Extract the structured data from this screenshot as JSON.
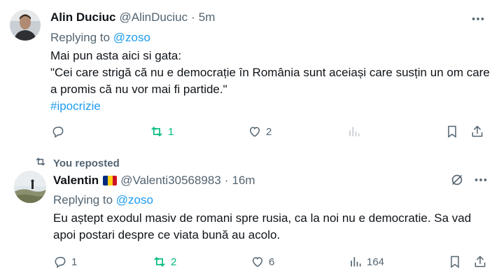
{
  "tweets": [
    {
      "author_name": "Alin Duciuc",
      "handle": "@AlinDuciuc",
      "separator": "·",
      "time": "5m",
      "replying_prefix": "Replying to",
      "replying_to": "@zoso",
      "lines": [
        "Mai pun asta aici si gata:",
        "\"Cei care strigă că nu e democrație în România sunt aceiași care susțin un om care a promis că nu vor mai fi partide.\""
      ],
      "hashtag": "#ipocrizie",
      "reply_count": "",
      "repost_count": "1",
      "like_count": "2",
      "view_count": ""
    },
    {
      "repost_label": "You reposted",
      "author_name": "Valentin",
      "handle": "@Valenti30568983",
      "separator": "·",
      "time": "16m",
      "replying_prefix": "Replying to",
      "replying_to": "@zoso",
      "text": "Eu aștept exodul masiv de romani spre rusia, ca la noi nu e democratie. Sa vad apoi postari despre ce viata bună au acolo.",
      "reply_count": "1",
      "repost_count": "2",
      "like_count": "6",
      "view_count": "164"
    }
  ],
  "colors": {
    "link": "#1d9bf0",
    "muted": "#536471",
    "repost_green": "#00ba7c",
    "text": "#0f1419"
  },
  "icons": [
    "reply-icon",
    "repost-icon",
    "like-icon",
    "views-icon",
    "bookmark-icon",
    "share-icon",
    "more-icon",
    "grok-icon",
    "flag-icon"
  ]
}
